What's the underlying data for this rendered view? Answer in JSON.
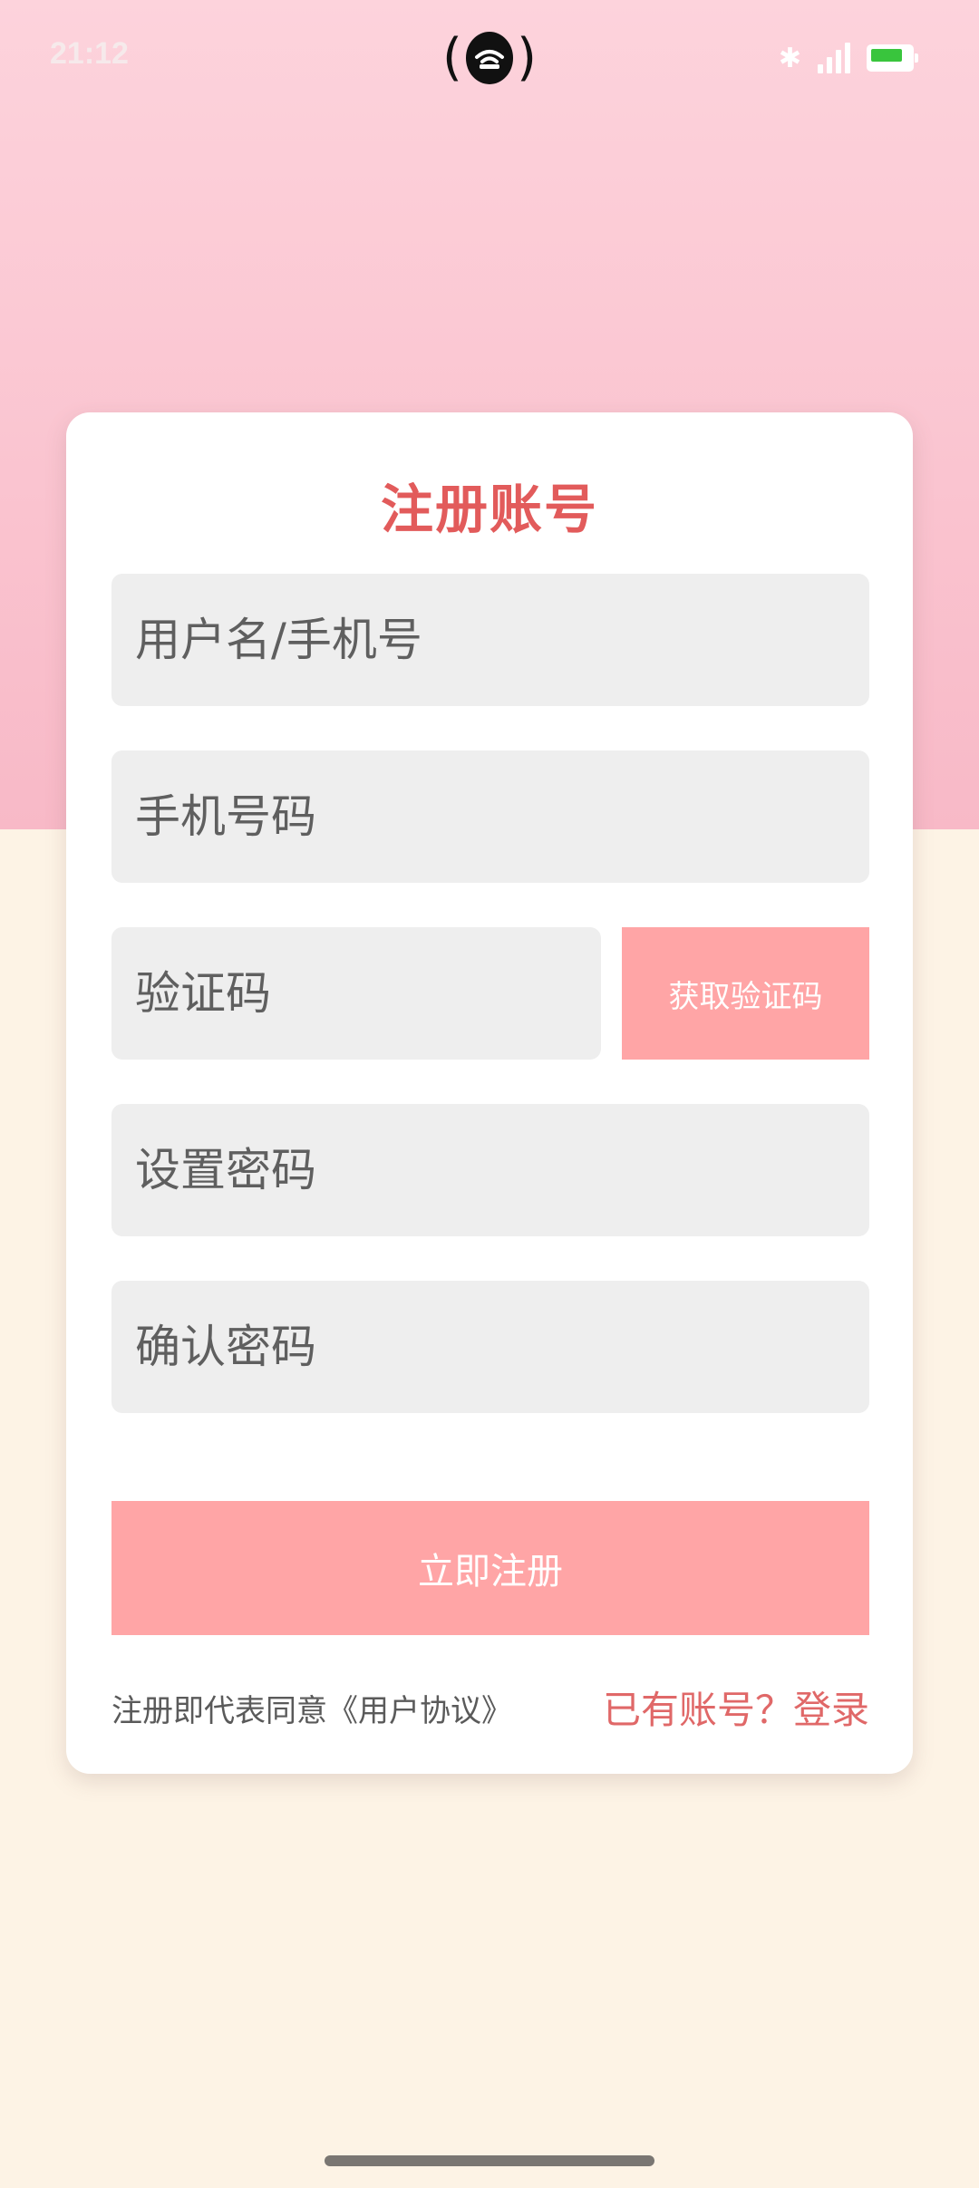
{
  "status_bar": {
    "time": "21:12",
    "icons": [
      "hotspot-icon",
      "bluetooth-icon",
      "signal-icon",
      "battery-icon"
    ]
  },
  "form": {
    "title": "注册账号",
    "username_placeholder": "用户名/手机号",
    "phone_placeholder": "手机号码",
    "code_placeholder": "验证码",
    "get_code_label": "获取验证码",
    "password_placeholder": "设置密码",
    "confirm_placeholder": "确认密码",
    "submit_label": "立即注册",
    "agreement_text": "注册即代表同意《用户协议》",
    "login_link": "已有账号？登录"
  },
  "colors": {
    "accent": "#e25b5b",
    "button": "#ffa5a6",
    "field_bg": "#eeeeee",
    "top_bg": "#f8b9c7",
    "bottom_bg": "#fdf3e5"
  }
}
